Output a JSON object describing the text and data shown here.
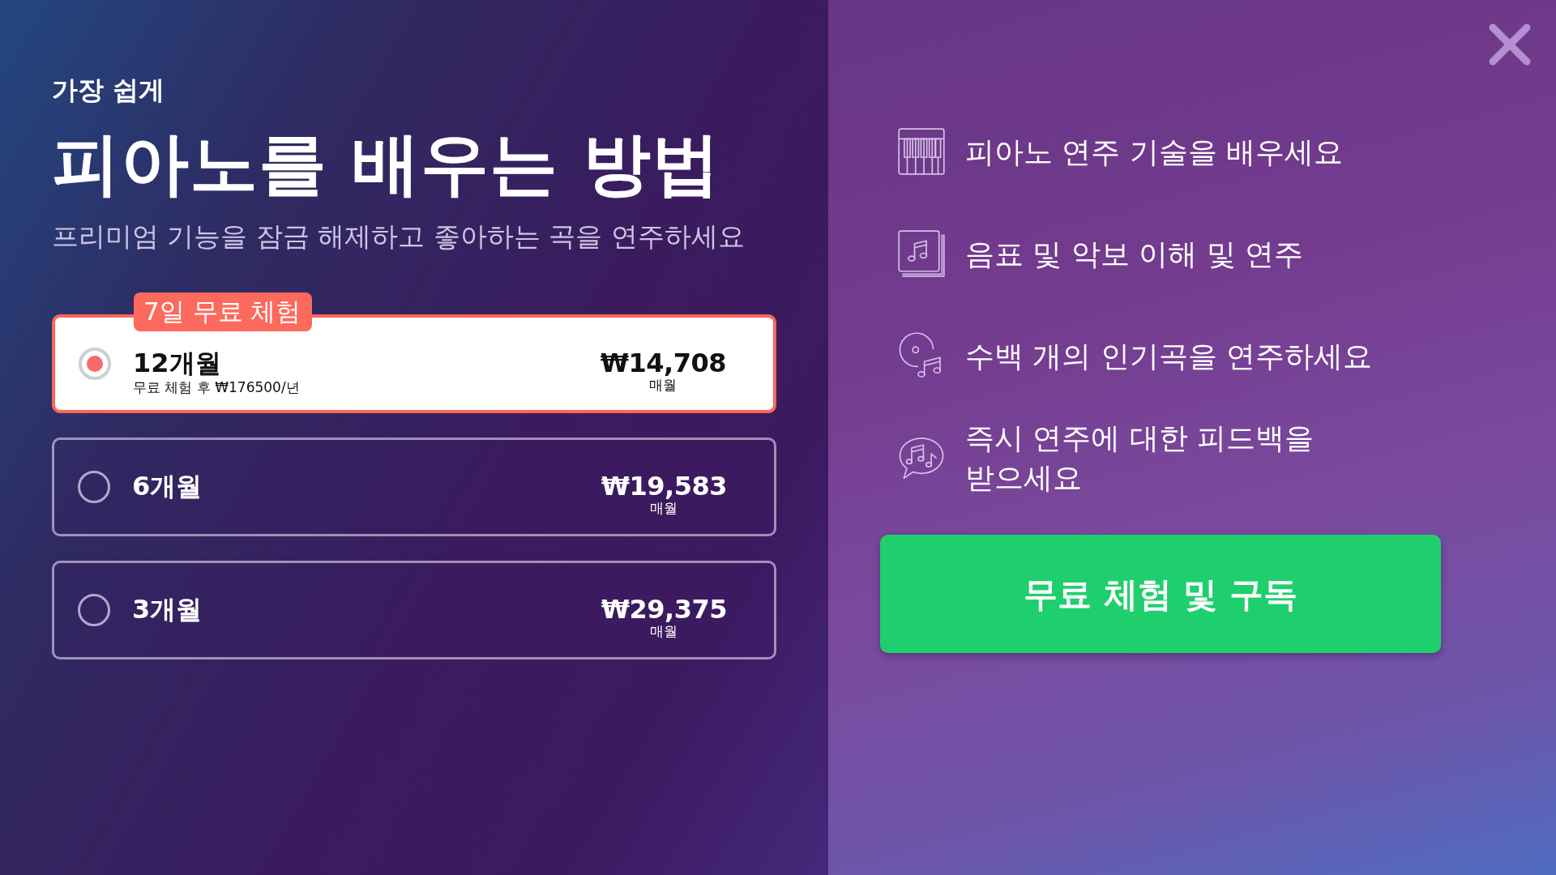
{
  "header": {
    "eyebrow": "가장 쉽게",
    "title": "피아노를 배우는 방법",
    "subtitle": "프리미엄 기능을 잠금 해제하고 좋아하는 곡을 연주하세요"
  },
  "plans": [
    {
      "badge": "7일 무료 체험",
      "name": "12개월",
      "note": "무료 체험 후 ₩176500/년",
      "price": "₩14,708",
      "period": "매월",
      "selected": true
    },
    {
      "name": "6개월",
      "price": "₩19,583",
      "period": "매월",
      "selected": false
    },
    {
      "name": "3개월",
      "price": "₩29,375",
      "period": "매월",
      "selected": false
    }
  ],
  "features": [
    "피아노 연주 기술을 배우세요",
    "음표 및 악보 이해 및 연주",
    "수백 개의 인기곡을 연주하세요",
    "즉시 연주에 대한 피드백을 받으세요"
  ],
  "cta_button": "무료 체험 및 구독"
}
